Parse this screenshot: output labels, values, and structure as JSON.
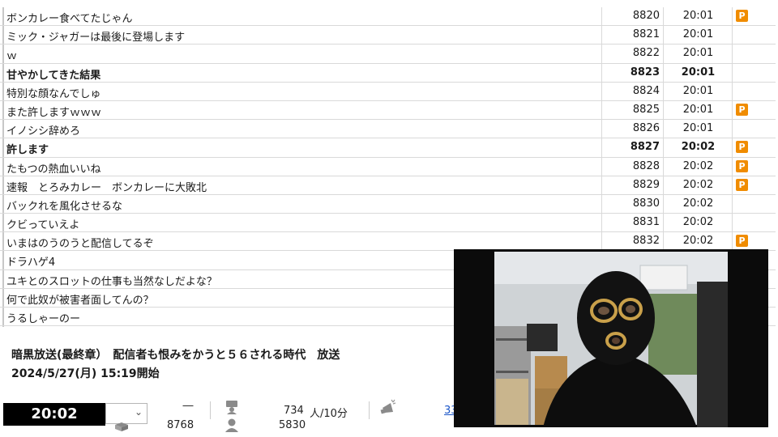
{
  "comments": [
    {
      "text": "ボンカレー食べてたじゃん",
      "number": "8820",
      "time": "20:01",
      "premium": true,
      "bold": false
    },
    {
      "text": "ミック・ジャガーは最後に登場します",
      "number": "8821",
      "time": "20:01",
      "premium": false,
      "bold": false
    },
    {
      "text": "ｗ",
      "number": "8822",
      "time": "20:01",
      "premium": false,
      "bold": false
    },
    {
      "text": "甘やかしてきた結果",
      "number": "8823",
      "time": "20:01",
      "premium": false,
      "bold": true
    },
    {
      "text": "特別な顔なんでしゅ",
      "number": "8824",
      "time": "20:01",
      "premium": false,
      "bold": false
    },
    {
      "text": "また許しますｗｗｗ",
      "number": "8825",
      "time": "20:01",
      "premium": true,
      "bold": false
    },
    {
      "text": "イノシシ辞めろ",
      "number": "8826",
      "time": "20:01",
      "premium": false,
      "bold": false
    },
    {
      "text": "許します",
      "number": "8827",
      "time": "20:02",
      "premium": true,
      "bold": true
    },
    {
      "text": "たもつの熱血いいね",
      "number": "8828",
      "time": "20:02",
      "premium": true,
      "bold": false
    },
    {
      "text": "速報　とろみカレー　ボンカレーに大敗北",
      "number": "8829",
      "time": "20:02",
      "premium": true,
      "bold": false
    },
    {
      "text": "バックれを風化させるな",
      "number": "8830",
      "time": "20:02",
      "premium": false,
      "bold": false
    },
    {
      "text": "クビっていえよ",
      "number": "8831",
      "time": "20:02",
      "premium": false,
      "bold": false
    },
    {
      "text": "いまはのうのうと配信してるぞ",
      "number": "8832",
      "time": "20:02",
      "premium": true,
      "bold": false
    },
    {
      "text": "ドラハゲ4",
      "number": "",
      "time": "",
      "premium": false,
      "bold": false
    },
    {
      "text": "ユキとのスロットの仕事も当然なしだよな？",
      "number": "",
      "time": "",
      "premium": false,
      "bold": false
    },
    {
      "text": "何で此奴が被害者面してんの？",
      "number": "",
      "time": "",
      "premium": false,
      "bold": false
    },
    {
      "text": "うるしゃーのー",
      "number": "",
      "time": "",
      "premium": false,
      "bold": false
    }
  ],
  "premium_badge_label": "P",
  "broadcast": {
    "title": "暗黒放送(最終章）　配信者も恨みをかうと５６される時代　放送",
    "start": "2024/5/27(月) 15:19開始"
  },
  "bottom_bar": {
    "clock": "20:02",
    "dropdown_value": "",
    "dash": "―",
    "comment_count": "8768",
    "viewers": "734",
    "viewers_unit": "人/10分",
    "visitors": "5830",
    "link_fragment": "33"
  },
  "icons": {
    "premium": "premium-badge-icon",
    "viewer": "viewer-icon",
    "visitor": "visitor-icon",
    "ad": "megaphone-icon",
    "gift": "gift-icon"
  },
  "colors": {
    "premium": "#f08c00",
    "clock_bg": "#000000",
    "link": "#1a55c8"
  }
}
